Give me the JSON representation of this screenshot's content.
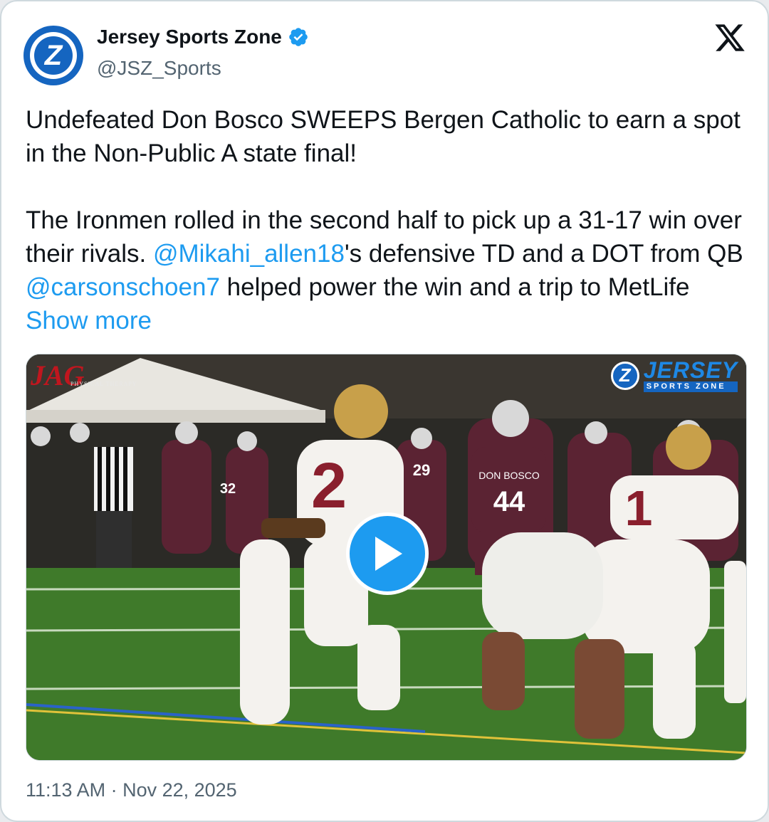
{
  "author": {
    "display_name": "Jersey Sports Zone",
    "handle": "@JSZ_Sports",
    "avatar_letter": "Z",
    "verified": true
  },
  "tweet": {
    "para1": "Undefeated Don Bosco SWEEPS Bergen Catholic to earn a spot in the Non-Public A state final!",
    "para2_a": "The Ironmen rolled in the second half to pick up a 31-17 win over their rivals. ",
    "mention1": "@Mikahi_allen18",
    "para2_b": "'s defensive TD and a DOT from QB ",
    "mention2": "@carsonschoen7",
    "para2_c": " helped power the win and a trip to MetLife ",
    "show_more": "Show more"
  },
  "media": {
    "type": "video",
    "watermark_left": "JAG",
    "watermark_left_sub": "PHYSICAL THERAPY",
    "watermark_right_letter": "Z",
    "watermark_right_big": "JERSEY",
    "watermark_right_small": "SPORTS ZONE",
    "jersey_numbers": [
      "2",
      "44",
      "1",
      "29",
      "32"
    ],
    "jersey_text": "DON BOSCO"
  },
  "timestamp": "11:13 AM · Nov 22, 2025",
  "colors": {
    "link": "#1d9bf0",
    "text": "#0f1419",
    "muted": "#536471",
    "verified": "#1d9bf0",
    "play_button": "#1d9bf0"
  },
  "icons": [
    "verified-badge-icon",
    "x-logo-icon",
    "play-icon"
  ]
}
